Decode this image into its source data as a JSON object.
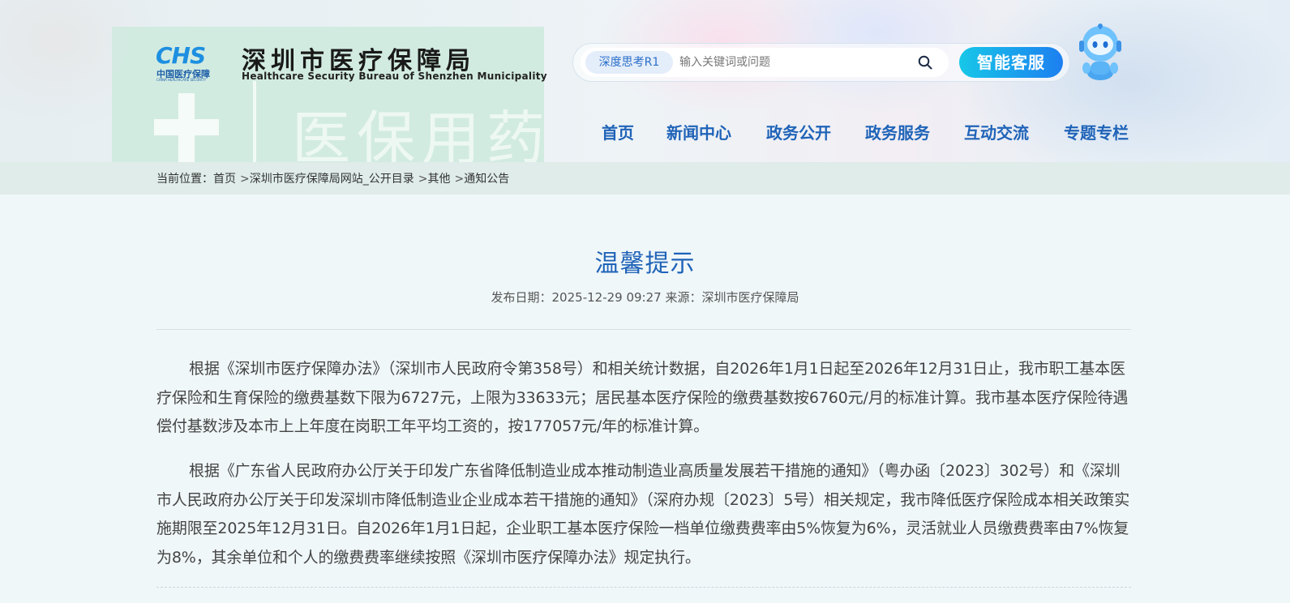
{
  "header": {
    "logo": {
      "mark": "CHS",
      "cn": "中国医疗保障",
      "en": "CHINA HEALTHCARE SECURITY"
    },
    "site_name": "深圳市医疗保障局",
    "site_name_en": "Healthcare Security Bureau of Shenzhen Municipality",
    "background_sign_text": "医保用药"
  },
  "search": {
    "tag": "深度思考R1",
    "placeholder": "输入关键词或问题",
    "ai_button": "智能客服"
  },
  "nav": {
    "items": [
      "首页",
      "新闻中心",
      "政务公开",
      "政务服务",
      "互动交流",
      "专题专栏"
    ]
  },
  "breadcrumb": {
    "label": "当前位置：",
    "items": [
      "首页",
      "深圳市医疗保障局网站_公开目录",
      "其他",
      "通知公告"
    ],
    "separator": ">"
  },
  "article": {
    "title": "温馨提示",
    "meta": "发布日期：2025-12-29 09:27 来源：深圳市医疗保障局",
    "paragraphs": [
      "根据《深圳市医疗保障办法》（深圳市人民政府令第358号）和相关统计数据，自2026年1月1日起至2026年12月31日止，我市职工基本医疗保险和生育保险的缴费基数下限为6727元，上限为33633元；居民基本医疗保险的缴费基数按6760元/月的标准计算。我市基本医疗保险待遇偿付基数涉及本市上上年度在岗职工年平均工资的，按177057元/年的标准计算。",
      "根据《广东省人民政府办公厅关于印发广东省降低制造业成本推动制造业高质量发展若干措施的通知》（粤办函〔2023〕302号）和《深圳市人民政府办公厅关于印发深圳市降低制造业企业成本若干措施的通知》（深府办规〔2023〕5号）相关规定，我市降低医疗保险成本相关政策实施期限至2025年12月31日。自2026年1月1日起，企业职工基本医疗保险一档单位缴费费率由5%恢复为6%，灵活就业人员缴费费率由7%恢复为8%，其余单位和个人的缴费费率继续按照《深圳市医疗保障办法》规定执行。"
    ]
  },
  "colors": {
    "nav_text": "#1f63b8",
    "title": "#1f63b8",
    "ai_button_from": "#17c7e8",
    "ai_button_to": "#1d7ff0",
    "breadcrumb_band": "#dfece9",
    "page_bg": "#f0f7f9"
  },
  "icons": {
    "search": "search-icon",
    "assistant": "robot-assistant-icon"
  }
}
